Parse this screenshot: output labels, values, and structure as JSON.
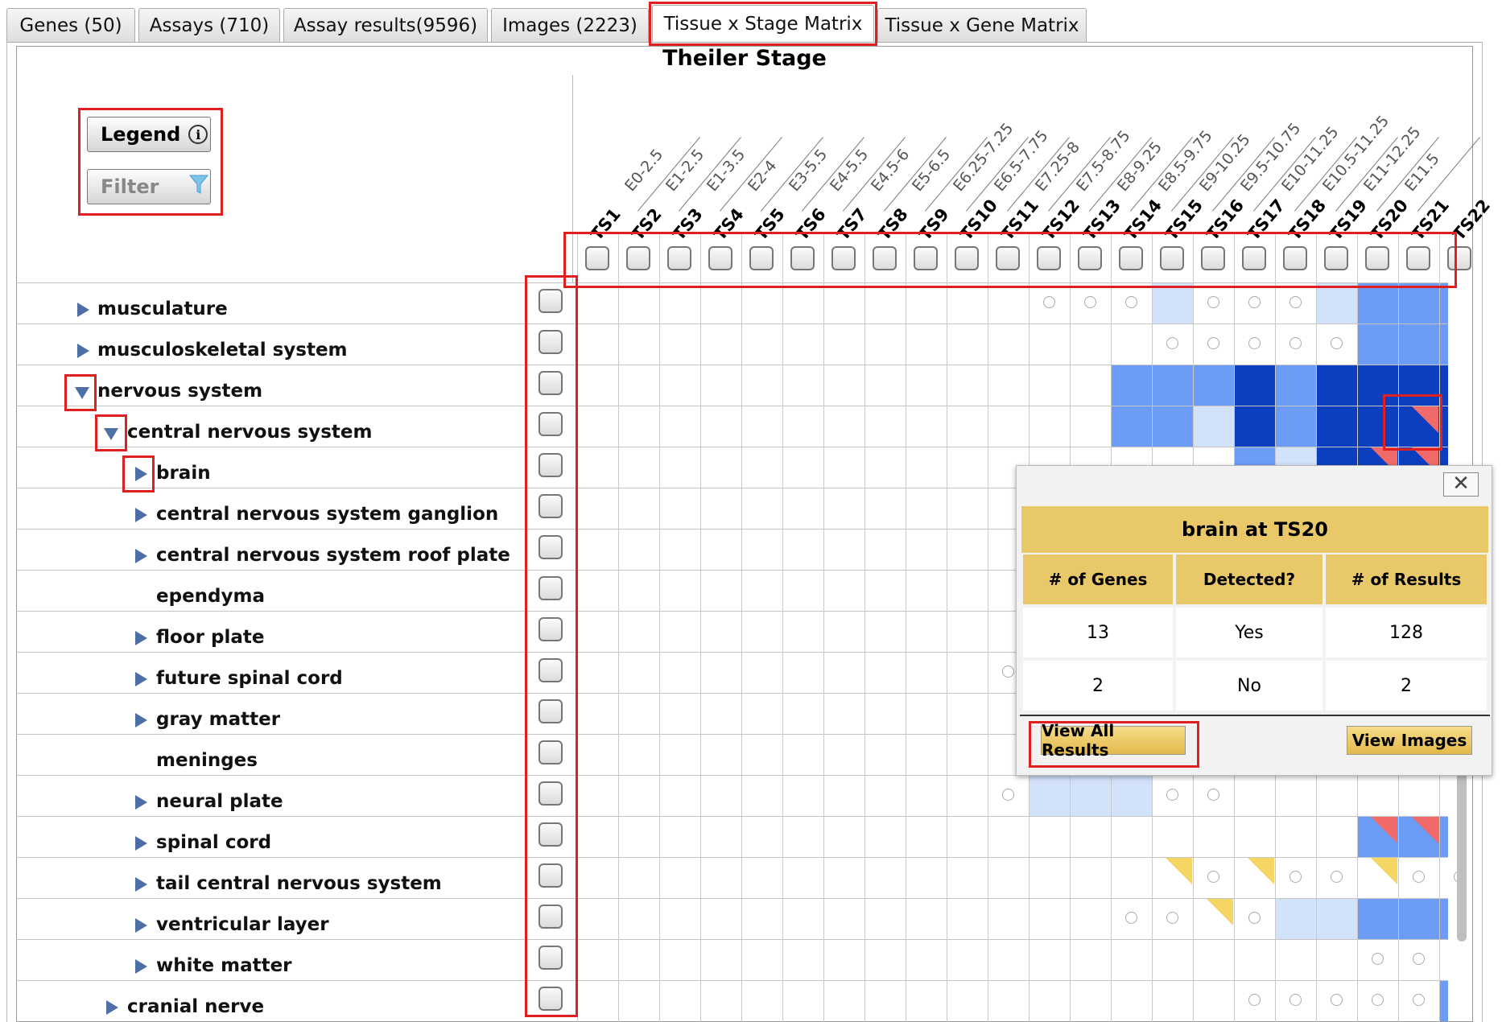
{
  "tabs": [
    {
      "label": "Genes (50)"
    },
    {
      "label": "Assays (710)"
    },
    {
      "label": "Assay results(9596)"
    },
    {
      "label": "Images (2223)"
    },
    {
      "label": "Tissue x Stage Matrix"
    },
    {
      "label": "Tissue x Gene Matrix"
    }
  ],
  "matrix": {
    "title": "Theiler Stage",
    "legend_label": "Legend",
    "filter_label": "Filter",
    "stages": [
      "TS1",
      "TS2",
      "TS3",
      "TS4",
      "TS5",
      "TS6",
      "TS7",
      "TS8",
      "TS9",
      "TS10",
      "TS11",
      "TS12",
      "TS13",
      "TS14",
      "TS15",
      "TS16",
      "TS17",
      "TS18",
      "TS19",
      "TS20",
      "TS21",
      "TS22"
    ],
    "ages": [
      "E0-2.5",
      "E1-2.5",
      "E1-3.5",
      "E2-4",
      "E3-5.5",
      "E4-5.5",
      "E4.5-6",
      "E5-6.5",
      "E6.25-7.25",
      "E6.5-7.75",
      "E7.25-8",
      "E7.5-8.75",
      "E8-9.25",
      "E8.5-9.75",
      "E9-10.25",
      "E9.5-10.75",
      "E10-11.25",
      "E10.5-11.25",
      "E11-12.25",
      "E11.5"
    ]
  },
  "tree": [
    {
      "label": "musculature",
      "expander": "collapsed"
    },
    {
      "label": "musculoskeletal system",
      "expander": "collapsed"
    },
    {
      "label": "nervous system",
      "expander": "expanded"
    },
    {
      "label": "central nervous system",
      "expander": "expanded"
    },
    {
      "label": "brain",
      "expander": "collapsed"
    },
    {
      "label": "central nervous system ganglion",
      "expander": "collapsed"
    },
    {
      "label": "central nervous system roof plate",
      "expander": "collapsed"
    },
    {
      "label": "ependyma",
      "expander": "none"
    },
    {
      "label": "floor plate",
      "expander": "collapsed"
    },
    {
      "label": "future spinal cord",
      "expander": "collapsed"
    },
    {
      "label": "gray matter",
      "expander": "collapsed"
    },
    {
      "label": "meninges",
      "expander": "none"
    },
    {
      "label": "neural plate",
      "expander": "collapsed"
    },
    {
      "label": "spinal cord",
      "expander": "collapsed"
    },
    {
      "label": "tail central nervous system",
      "expander": "collapsed"
    },
    {
      "label": "ventricular layer",
      "expander": "collapsed"
    },
    {
      "label": "white matter",
      "expander": "collapsed"
    },
    {
      "label": "cranial nerve",
      "expander": "collapsed"
    }
  ],
  "cells": [
    {
      "r": 0,
      "c": 11,
      "t": "dot"
    },
    {
      "r": 0,
      "c": 12,
      "t": "dot"
    },
    {
      "r": 0,
      "c": 13,
      "t": "dot"
    },
    {
      "r": 0,
      "c": 14,
      "t": "pale"
    },
    {
      "r": 0,
      "c": 15,
      "t": "dot"
    },
    {
      "r": 0,
      "c": 16,
      "t": "dot"
    },
    {
      "r": 0,
      "c": 17,
      "t": "dot"
    },
    {
      "r": 0,
      "c": 18,
      "t": "pale"
    },
    {
      "r": 0,
      "c": 19,
      "t": "mid"
    },
    {
      "r": 0,
      "c": 20,
      "t": "mid"
    },
    {
      "r": 0,
      "c": 21,
      "t": "mid"
    },
    {
      "r": 1,
      "c": 14,
      "t": "dot"
    },
    {
      "r": 1,
      "c": 15,
      "t": "dot"
    },
    {
      "r": 1,
      "c": 16,
      "t": "dot"
    },
    {
      "r": 1,
      "c": 17,
      "t": "dot"
    },
    {
      "r": 1,
      "c": 18,
      "t": "dot"
    },
    {
      "r": 1,
      "c": 19,
      "t": "mid"
    },
    {
      "r": 1,
      "c": 20,
      "t": "mid"
    },
    {
      "r": 1,
      "c": 21,
      "t": "mid"
    },
    {
      "r": 2,
      "c": 13,
      "t": "mid"
    },
    {
      "r": 2,
      "c": 14,
      "t": "mid"
    },
    {
      "r": 2,
      "c": 15,
      "t": "mid"
    },
    {
      "r": 2,
      "c": 16,
      "t": "dark"
    },
    {
      "r": 2,
      "c": 17,
      "t": "mid"
    },
    {
      "r": 2,
      "c": 18,
      "t": "dark"
    },
    {
      "r": 2,
      "c": 19,
      "t": "dark"
    },
    {
      "r": 2,
      "c": 20,
      "t": "dark"
    },
    {
      "r": 2,
      "c": 21,
      "t": "dark"
    },
    {
      "r": 3,
      "c": 13,
      "t": "mid"
    },
    {
      "r": 3,
      "c": 14,
      "t": "mid"
    },
    {
      "r": 3,
      "c": 15,
      "t": "pale"
    },
    {
      "r": 3,
      "c": 16,
      "t": "dark"
    },
    {
      "r": 3,
      "c": 17,
      "t": "mid"
    },
    {
      "r": 3,
      "c": 18,
      "t": "dark"
    },
    {
      "r": 3,
      "c": 19,
      "t": "dark"
    },
    {
      "r": 3,
      "c": 20,
      "t": "dark",
      "tri": "red"
    },
    {
      "r": 3,
      "c": 21,
      "t": "dark"
    },
    {
      "r": 4,
      "c": 16,
      "t": "mid"
    },
    {
      "r": 4,
      "c": 17,
      "t": "pale"
    },
    {
      "r": 4,
      "c": 18,
      "t": "dark"
    },
    {
      "r": 4,
      "c": 19,
      "t": "dark",
      "tri": "red"
    },
    {
      "r": 4,
      "c": 20,
      "t": "dark",
      "tri": "red"
    },
    {
      "r": 4,
      "c": 21,
      "t": "dark"
    },
    {
      "r": 9,
      "c": 10,
      "t": "dot"
    },
    {
      "r": 12,
      "c": 10,
      "t": "dot"
    },
    {
      "r": 12,
      "c": 11,
      "t": "pale"
    },
    {
      "r": 12,
      "c": 12,
      "t": "pale"
    },
    {
      "r": 12,
      "c": 13,
      "t": "pale"
    },
    {
      "r": 12,
      "c": 14,
      "t": "dot"
    },
    {
      "r": 12,
      "c": 15,
      "t": "dot"
    },
    {
      "r": 13,
      "c": 19,
      "t": "mid",
      "tri": "red"
    },
    {
      "r": 13,
      "c": 20,
      "t": "mid",
      "tri": "red"
    },
    {
      "r": 13,
      "c": 21,
      "t": "mid"
    },
    {
      "r": 14,
      "c": 14,
      "t": "none",
      "tri": "yel"
    },
    {
      "r": 14,
      "c": 15,
      "t": "dot"
    },
    {
      "r": 14,
      "c": 16,
      "t": "none",
      "tri": "yel"
    },
    {
      "r": 14,
      "c": 17,
      "t": "dot"
    },
    {
      "r": 14,
      "c": 18,
      "t": "dot"
    },
    {
      "r": 14,
      "c": 19,
      "t": "none",
      "tri": "yel"
    },
    {
      "r": 14,
      "c": 20,
      "t": "dot"
    },
    {
      "r": 14,
      "c": 21,
      "t": "dot"
    },
    {
      "r": 15,
      "c": 13,
      "t": "dot"
    },
    {
      "r": 15,
      "c": 14,
      "t": "dot"
    },
    {
      "r": 15,
      "c": 15,
      "t": "none",
      "tri": "yel"
    },
    {
      "r": 15,
      "c": 16,
      "t": "dot"
    },
    {
      "r": 15,
      "c": 17,
      "t": "pale"
    },
    {
      "r": 15,
      "c": 18,
      "t": "pale"
    },
    {
      "r": 15,
      "c": 19,
      "t": "mid"
    },
    {
      "r": 15,
      "c": 20,
      "t": "mid"
    },
    {
      "r": 15,
      "c": 21,
      "t": "mid"
    },
    {
      "r": 16,
      "c": 19,
      "t": "dot"
    },
    {
      "r": 16,
      "c": 20,
      "t": "dot"
    },
    {
      "r": 17,
      "c": 16,
      "t": "dot"
    },
    {
      "r": 17,
      "c": 17,
      "t": "dot"
    },
    {
      "r": 17,
      "c": 18,
      "t": "dot"
    },
    {
      "r": 17,
      "c": 19,
      "t": "dot"
    },
    {
      "r": 17,
      "c": 20,
      "t": "dot"
    },
    {
      "r": 17,
      "c": 21,
      "t": "mid"
    }
  ],
  "popup": {
    "title": "brain at TS20",
    "close_label": "✕",
    "headers": [
      "# of Genes",
      "Detected?",
      "# of Results"
    ],
    "rows": [
      [
        "13",
        "Yes",
        "128"
      ],
      [
        "2",
        "No",
        "2"
      ]
    ],
    "view_all_label": "View All Results",
    "view_images_label": "View Images"
  },
  "colors": {
    "pale": "#d3e2fb",
    "mid": "#6c9cf5",
    "dark": "#0b3fbf",
    "highlight": "#e02020",
    "popup_header": "#e9c869"
  }
}
